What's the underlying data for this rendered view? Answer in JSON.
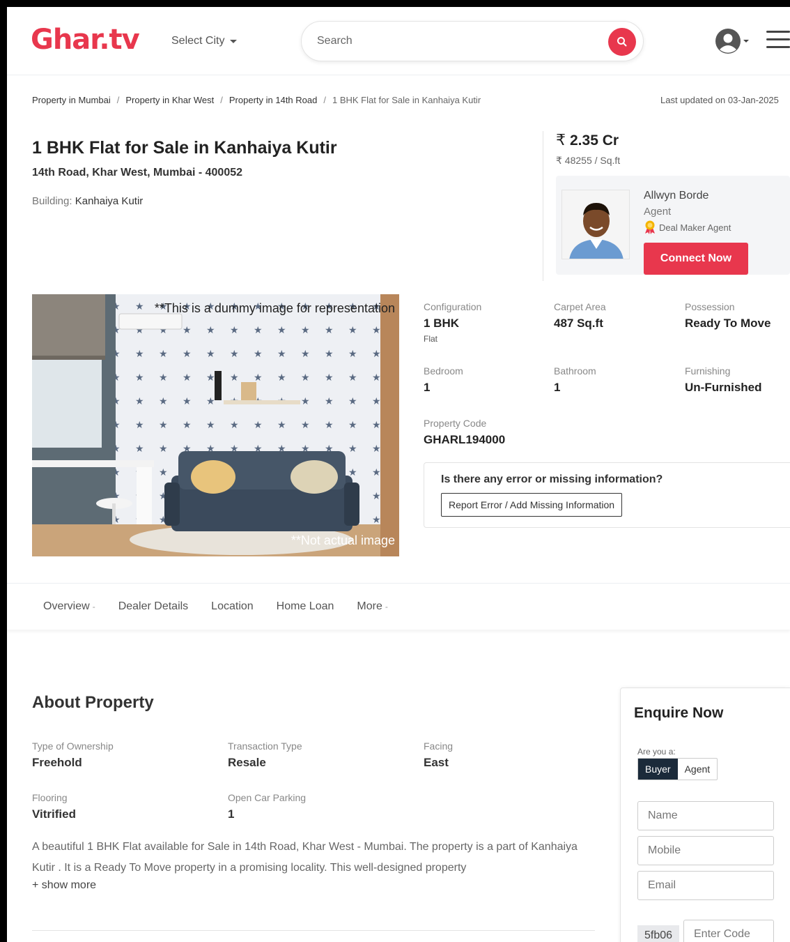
{
  "header": {
    "logo": "Ghar.tv",
    "city_label": "Select City",
    "search_placeholder": "Search"
  },
  "breadcrumb": {
    "items": [
      "Property in Mumbai",
      "Property in Khar West",
      "Property in 14th Road"
    ],
    "current": "1 BHK Flat for Sale in Kanhaiya Kutir",
    "separator": "/"
  },
  "last_updated": "Last updated on 03-Jan-2025",
  "listing": {
    "title": "1 BHK Flat for Sale in Kanhaiya Kutir",
    "address": "14th Road, Khar West, Mumbai - 400052",
    "building_label": "Building:",
    "building_name": "Kanhaiya Kutir",
    "price_symbol": "₹",
    "price": "2.35 Cr",
    "price_per_sqft": "₹ 48255 / Sq.ft"
  },
  "agent": {
    "name": "Allwyn Borde",
    "role": "Agent",
    "badge": "Deal Maker Agent",
    "connect_label": "Connect Now"
  },
  "image_notes": {
    "top": "**This is a dummy image for representation",
    "bottom": "**Not actual image"
  },
  "specs": {
    "configuration": {
      "label": "Configuration",
      "value": "1 BHK",
      "sub": "Flat"
    },
    "carpet_area": {
      "label": "Carpet Area",
      "value": "487 Sq.ft"
    },
    "possession": {
      "label": "Possession",
      "value": "Ready To Move"
    },
    "bedroom": {
      "label": "Bedroom",
      "value": "1"
    },
    "bathroom": {
      "label": "Bathroom",
      "value": "1"
    },
    "furnishing": {
      "label": "Furnishing",
      "value": "Un-Furnished"
    },
    "property_code": {
      "label": "Property Code",
      "value": "GHARL194000"
    }
  },
  "error_report": {
    "question": "Is there any error or missing information?",
    "button": "Report Error / Add Missing Information"
  },
  "tabs": [
    "Overview",
    "Dealer Details",
    "Location",
    "Home Loan",
    "More"
  ],
  "tab_dash": "-",
  "about": {
    "title": "About Property",
    "ownership": {
      "label": "Type of Ownership",
      "value": "Freehold"
    },
    "transaction": {
      "label": "Transaction Type",
      "value": "Resale"
    },
    "facing": {
      "label": "Facing",
      "value": "East"
    },
    "flooring": {
      "label": "Flooring",
      "value": "Vitrified"
    },
    "parking": {
      "label": "Open Car Parking",
      "value": "1"
    },
    "description": "A beautiful 1 BHK Flat available for Sale in 14th Road, Khar West - Mumbai. The property is a part of Kanhaiya Kutir . It is a Ready To Move property in a promising locality. This well-designed property",
    "show_more": "+ show more"
  },
  "enquiry": {
    "title": "Enquire Now",
    "question": "Are you a:",
    "options": [
      "Buyer",
      "Agent"
    ],
    "selected": "Buyer",
    "name_placeholder": "Name",
    "mobile_placeholder": "Mobile",
    "email_placeholder": "Email",
    "captcha": "5fb06",
    "code_placeholder": "Enter Code"
  },
  "colors": {
    "brand": "#e8374d",
    "dark": "#1b2a3a"
  },
  "icons": [
    "search-icon",
    "user-icon",
    "menu-icon",
    "badge-icon"
  ]
}
